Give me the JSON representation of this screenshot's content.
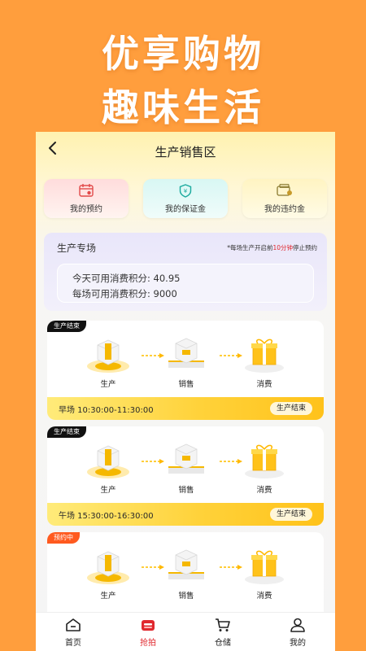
{
  "promo": {
    "line1": "优享购物",
    "line2": "趣味生活"
  },
  "nav": {
    "back_icon": "chevron-left-icon",
    "title": "生产销售区"
  },
  "quick_actions": [
    {
      "label": "我的预约",
      "icon": "calendar-icon"
    },
    {
      "label": "我的保证金",
      "icon": "shield-icon"
    },
    {
      "label": "我的违约金",
      "icon": "wallet-icon"
    }
  ],
  "production_zone": {
    "title": "生产专场",
    "note_prefix": "*每场生产开启前",
    "note_highlight": "10分钟",
    "note_suffix": "停止预约",
    "today_label": "今天可用消费积分:",
    "today_value": "40.95",
    "per_session_label": "每场可用消费积分:",
    "per_session_value": "9000"
  },
  "sessions": [
    {
      "status_tag": "生产结束",
      "steps": [
        "生产",
        "销售",
        "消费"
      ],
      "time_text": "早场  10:30:00-11:30:00",
      "button_label": "生产结束"
    },
    {
      "status_tag": "生产结束",
      "steps": [
        "生产",
        "销售",
        "消费"
      ],
      "time_text": "午场  15:30:00-16:30:00",
      "button_label": "生产结束"
    },
    {
      "status_tag": "预约中",
      "steps": [
        "生产",
        "销售",
        "消费"
      ],
      "time_text": "",
      "button_label": ""
    }
  ],
  "tabbar": [
    {
      "label": "首页",
      "icon": "home-icon",
      "active": false
    },
    {
      "label": "抢拍",
      "icon": "auction-icon",
      "active": true
    },
    {
      "label": "仓储",
      "icon": "cart-icon",
      "active": false
    },
    {
      "label": "我的",
      "icon": "user-icon",
      "active": false
    }
  ],
  "colors": {
    "background": "#FF9E3D",
    "accent_red": "#E0282E",
    "bar_yellow": "#FFD23A",
    "tag_dark": "#111111",
    "tag_orange": "#FF5A1F"
  }
}
